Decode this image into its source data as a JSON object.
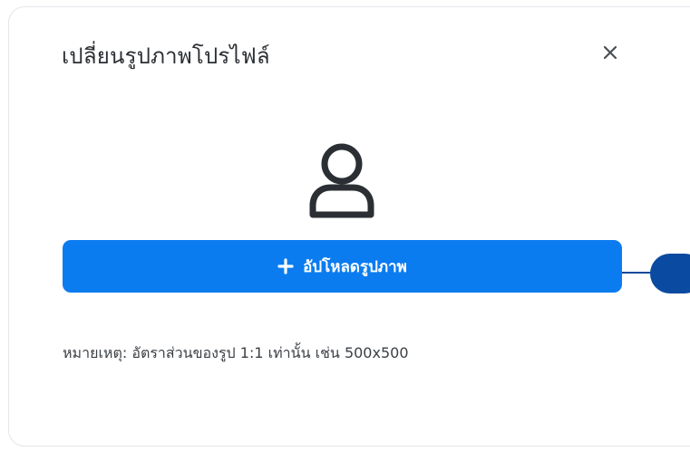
{
  "dialog": {
    "title": "เปลี่ยนรูปภาพโปรไฟล์",
    "close_icon": "close-icon",
    "avatar_icon": "user-icon",
    "upload_button": {
      "icon": "plus-icon",
      "label": "อัปโหลดรูปภาพ"
    },
    "note": "หมายเหตุ: อัตราส่วนของรูป 1:1 เท่านั้น เช่น 500x500"
  },
  "colors": {
    "primary": "#0b7cf0",
    "callout": "#0a4aa0",
    "title_text": "#2b2f33",
    "note_text": "#3a3f44"
  }
}
